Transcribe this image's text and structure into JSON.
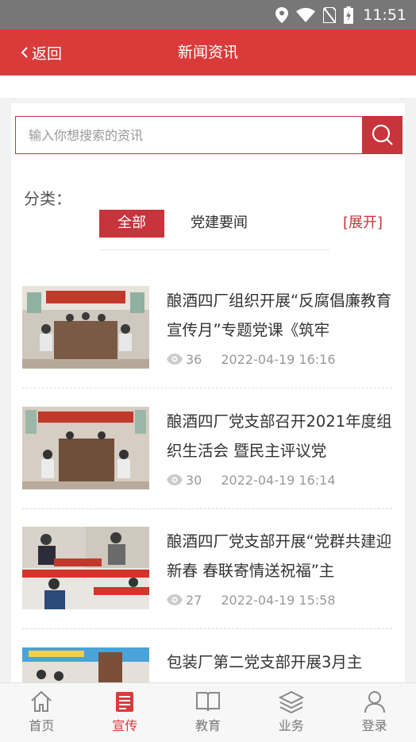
{
  "status_bar": {
    "time": "11:51"
  },
  "header": {
    "back_label": "返回",
    "title": "新闻资讯"
  },
  "search": {
    "placeholder": "输入你想搜索的资讯"
  },
  "categories": {
    "label": "分类：",
    "tabs": [
      {
        "label": "全部",
        "active": true
      },
      {
        "label": "党建要闻",
        "active": false
      }
    ],
    "expand_label": "[展开]"
  },
  "news": [
    {
      "title": "酿酒四厂组织开展“反腐倡廉教育宣传月”专题党课《筑牢",
      "views": "36",
      "date": "2022-04-19 16:16"
    },
    {
      "title": "酿酒四厂党支部召开2021年度组织生活会 暨民主评议党",
      "views": "30",
      "date": "2022-04-19 16:14"
    },
    {
      "title": "酿酒四厂党支部开展“党群共建迎新春 春联寄情送祝福”主",
      "views": "27",
      "date": "2022-04-19 15:58"
    },
    {
      "title": "包装厂第二党支部开展3月主",
      "views": "",
      "date": ""
    }
  ],
  "bottom_nav": [
    {
      "label": "首页",
      "icon": "home-icon",
      "active": false
    },
    {
      "label": "宣传",
      "icon": "document-icon",
      "active": true
    },
    {
      "label": "教育",
      "icon": "book-icon",
      "active": false
    },
    {
      "label": "业务",
      "icon": "layers-icon",
      "active": false
    },
    {
      "label": "登录",
      "icon": "user-icon",
      "active": false
    }
  ],
  "colors": {
    "header": "#d93b3b",
    "accent": "#c8343b",
    "status_bar": "#777777"
  }
}
